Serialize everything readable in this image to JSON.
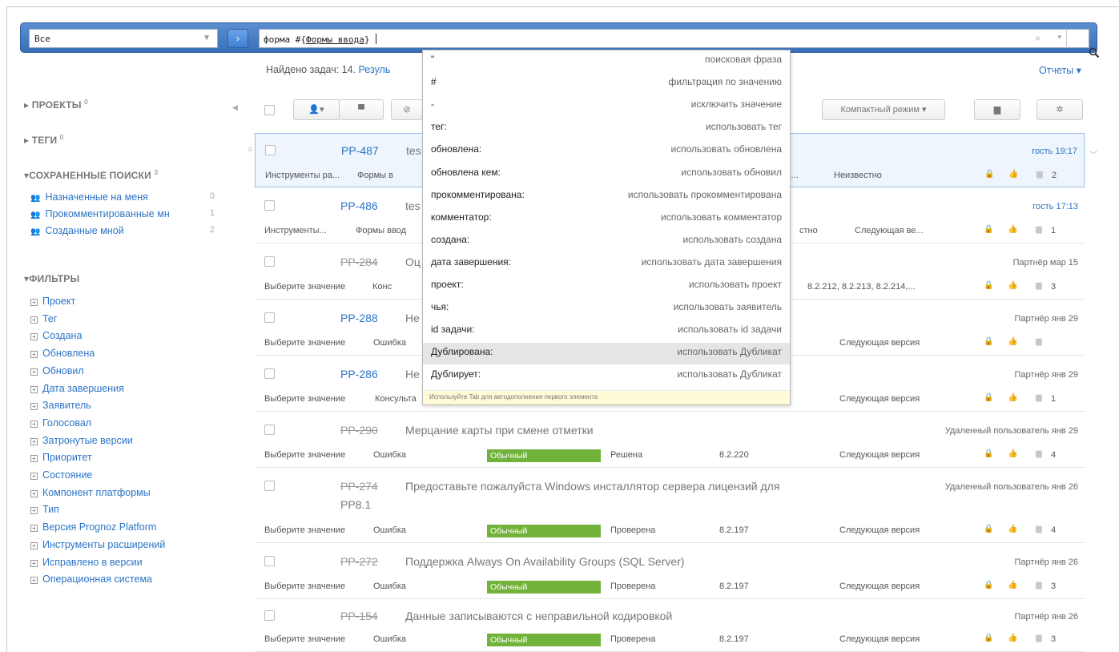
{
  "search": {
    "scope_value": "Все",
    "go_icon": "chevron-right-icon",
    "query_prefix": "форма #{",
    "query_underlined": "Формы ввода",
    "query_suffix": "}",
    "clear_symbol": "×",
    "dropdown_symbol": "▾",
    "search_icon": "magnifier-icon"
  },
  "results": {
    "found_text": "Найдено задач: 14.",
    "found_link": "Резуль",
    "reports_label": "Отчеты ▾"
  },
  "toolbar": {
    "compact_mode": "Компактный режим ▾"
  },
  "sidebar": {
    "projects": "ПРОЕКТЫ",
    "projects_count": "0",
    "tags": "ТЕГИ",
    "tags_count": "0",
    "saved": "СОХРАНЕННЫЕ ПОИСКИ",
    "saved_count": "3",
    "saved_items": [
      {
        "label": "Назначенные на меня",
        "count": "0"
      },
      {
        "label": "Прокомментированные мн",
        "count": "1"
      },
      {
        "label": "Созданные мной",
        "count": "2"
      }
    ],
    "filters": "ФИЛЬТРЫ",
    "filter_items": [
      "Проект",
      "Тег",
      "Создана",
      "Обновлена",
      "Обновил",
      "Дата завершения",
      "Заявитель",
      "Голосовал",
      "Затронутые версии",
      "Приоритет",
      "Состояние",
      "Компонент платформы",
      "Тип",
      "Версия Prognoz Platform",
      "Инструменты расширений",
      "Исправлено в версии",
      "Операционная система"
    ]
  },
  "rows": [
    {
      "id": "PP-487",
      "title": "tes",
      "strike": false,
      "who": "гость 19:17",
      "who_blue": true,
      "meta": [
        "Инструменты ра...",
        "Формы в",
        "уто...",
        "Неизвестно"
      ],
      "comments": "2"
    },
    {
      "id": "PP-486",
      "title": "tes",
      "strike": false,
      "who": "гость 17:13",
      "who_blue": true,
      "meta": [
        "Инструменты...",
        "Формы ввод",
        "стно",
        "Следующая ве..."
      ],
      "comments": "1"
    },
    {
      "id": "PP-284",
      "title": "Оц",
      "strike": true,
      "who": "Партнёр мар 15",
      "who_blue": false,
      "meta": [
        "Выберите значение",
        "Конс",
        "8.2.212, 8.2.213, 8.2.214,..."
      ],
      "comments": "3"
    },
    {
      "id": "PP-288",
      "title": "Не",
      "strike": false,
      "who": "Партнёр янв 29",
      "who_blue": false,
      "meta": [
        "Выберите значение",
        "Ошибка",
        "Следующая версия"
      ],
      "comments": ""
    },
    {
      "id": "PP-286",
      "title": "Не",
      "strike": false,
      "who": "Партнёр янв 29",
      "who_blue": false,
      "meta": [
        "Выберите значение",
        "Консульта",
        "Следующая версия"
      ],
      "comments": "1"
    },
    {
      "id": "PP-290",
      "title": "Мерцание карты при смене отметки",
      "strike": true,
      "who": "Удаленный пользователь янв 29",
      "who_blue": false,
      "meta": [
        "Выберите значение",
        "Ошибка",
        "Обычный",
        "Решена",
        "8.2.220",
        "Следующая версия"
      ],
      "comments": "4"
    },
    {
      "id": "PP-274",
      "title": "Предоставьте пожалуйста Windows инсталлятор сервера лицензий для",
      "title2": "PP8.1",
      "strike": true,
      "who": "Удаленный пользователь янв 26",
      "who_blue": false,
      "meta": [
        "Выберите значение",
        "Ошибка",
        "Обычный",
        "Проверена",
        "8.2.197",
        "Следующая версия"
      ],
      "comments": "4"
    },
    {
      "id": "PP-272",
      "title": "Поддержка Always On Availability Groups (SQL Server)",
      "strike": true,
      "who": "Партнёр янв 26",
      "who_blue": false,
      "meta": [
        "Выберите значение",
        "Ошибка",
        "Обычный",
        "Проверена",
        "8.2.197",
        "Следующая версия"
      ],
      "comments": "3"
    },
    {
      "id": "PP-154",
      "title": "Данные записываются с неправильной кодировкой",
      "strike": true,
      "who": "Партнёр янв 26",
      "who_blue": false,
      "meta": [
        "Выберите значение",
        "Ошибка",
        "Обычный",
        "Проверена",
        "8.2.197",
        "Следующая версия"
      ],
      "comments": "3"
    }
  ],
  "autocomplete": {
    "items": [
      {
        "k": "\"",
        "v": "поисковая фраза"
      },
      {
        "k": "#",
        "v": "фильтрация по значению"
      },
      {
        "k": "-",
        "v": "исключить значение"
      },
      {
        "k": "тег:",
        "v": "использовать тег"
      },
      {
        "k": "обновлена:",
        "v": "использовать обновлена"
      },
      {
        "k": "обновлена кем:",
        "v": "использовать обновил"
      },
      {
        "k": "прокомментирована:",
        "v": "использовать прокомментирована"
      },
      {
        "k": "комментатор:",
        "v": "использовать комментатор"
      },
      {
        "k": "создана:",
        "v": "использовать создана"
      },
      {
        "k": "дата завершения:",
        "v": "использовать дата завершения"
      },
      {
        "k": "проект:",
        "v": "использовать проект"
      },
      {
        "k": "чья:",
        "v": "использовать заявитель"
      },
      {
        "k": "id задачи:",
        "v": "использовать id задачи"
      },
      {
        "k": "Дублирована:",
        "v": "использовать Дубликат",
        "hl": true
      },
      {
        "k": "Дублирует:",
        "v": "использовать Дубликат"
      }
    ],
    "hint": "Используйте Tab для автодополнения первого элемента"
  },
  "colors": {
    "accent": "#3a6fb8",
    "priority_normal": "#71b23b",
    "priority_orange": "#ee7d31",
    "link": "#2b74c7"
  }
}
